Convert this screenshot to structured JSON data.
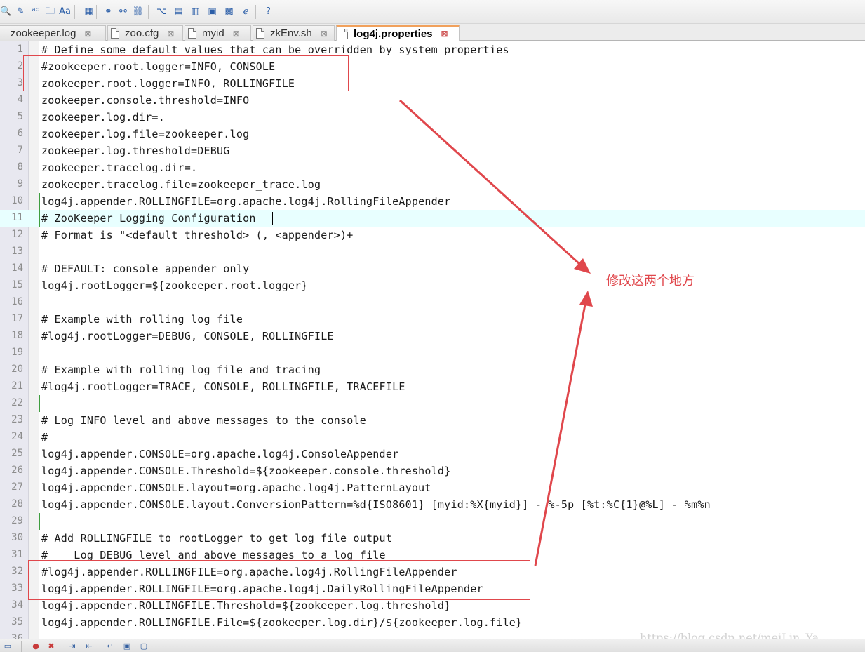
{
  "colors": {
    "annotation": "#e0474c",
    "change_marker": "#3f9e3f",
    "current_line": "#e8ffff",
    "active_tab_accent": "#f1a15c"
  },
  "toolbar": {
    "icons": [
      {
        "name": "find-icon",
        "glyph": "🔍"
      },
      {
        "name": "edit-note-icon",
        "glyph": "✎"
      },
      {
        "name": "replace-abc-icon",
        "glyph": "ᵃᶜ"
      },
      {
        "name": "find-in-files-icon",
        "glyph": "🗀"
      },
      {
        "name": "text-format-icon",
        "glyph": "Aa"
      },
      {
        "name": "calculator-icon",
        "glyph": "▦"
      },
      {
        "name": "link-icon",
        "glyph": "⚭"
      },
      {
        "name": "link-alt-icon",
        "glyph": "⚯"
      },
      {
        "name": "link-group-icon",
        "glyph": "⛓"
      },
      {
        "name": "tree-view-icon",
        "glyph": "⌥"
      },
      {
        "name": "panel-left-icon",
        "glyph": "▤"
      },
      {
        "name": "panel-right-icon",
        "glyph": "▥"
      },
      {
        "name": "window-icon",
        "glyph": "▣"
      },
      {
        "name": "grid-icon",
        "glyph": "▩"
      },
      {
        "name": "browser-icon",
        "glyph": "ℯ"
      },
      {
        "name": "help-icon",
        "glyph": "?"
      }
    ]
  },
  "tabs": [
    {
      "label": "zookeeper.log",
      "active": false
    },
    {
      "label": "zoo.cfg",
      "active": false
    },
    {
      "label": "myid",
      "active": false
    },
    {
      "label": "zkEnv.sh",
      "active": false
    },
    {
      "label": "log4j.properties",
      "active": true
    }
  ],
  "tab_close_glyph": "⊠",
  "editor": {
    "current_line": 11,
    "changed_lines": [
      10,
      11,
      22,
      29
    ],
    "lines": [
      {
        "n": "1",
        "text": "# Define some default values that can be overridden by system properties"
      },
      {
        "n": "2",
        "text": "#zookeeper.root.logger=INFO, CONSOLE"
      },
      {
        "n": "3",
        "text": "zookeeper.root.logger=INFO, ROLLINGFILE"
      },
      {
        "n": "4",
        "text": "zookeeper.console.threshold=INFO"
      },
      {
        "n": "5",
        "text": "zookeeper.log.dir=."
      },
      {
        "n": "6",
        "text": "zookeeper.log.file=zookeeper.log"
      },
      {
        "n": "7",
        "text": "zookeeper.log.threshold=DEBUG"
      },
      {
        "n": "8",
        "text": "zookeeper.tracelog.dir=."
      },
      {
        "n": "9",
        "text": "zookeeper.tracelog.file=zookeeper_trace.log"
      },
      {
        "n": "10",
        "text": "log4j.appender.ROLLINGFILE=org.apache.log4j.RollingFileAppender"
      },
      {
        "n": "11",
        "text": "# ZooKeeper Logging Configuration"
      },
      {
        "n": "12",
        "text": "# Format is \"<default threshold> (, <appender>)+"
      },
      {
        "n": "13",
        "text": ""
      },
      {
        "n": "14",
        "text": "# DEFAULT: console appender only"
      },
      {
        "n": "15",
        "text": "log4j.rootLogger=${zookeeper.root.logger}"
      },
      {
        "n": "16",
        "text": ""
      },
      {
        "n": "17",
        "text": "# Example with rolling log file"
      },
      {
        "n": "18",
        "text": "#log4j.rootLogger=DEBUG, CONSOLE, ROLLINGFILE"
      },
      {
        "n": "19",
        "text": ""
      },
      {
        "n": "20",
        "text": "# Example with rolling log file and tracing"
      },
      {
        "n": "21",
        "text": "#log4j.rootLogger=TRACE, CONSOLE, ROLLINGFILE, TRACEFILE"
      },
      {
        "n": "22",
        "text": ""
      },
      {
        "n": "23",
        "text": "# Log INFO level and above messages to the console"
      },
      {
        "n": "24",
        "text": "#"
      },
      {
        "n": "25",
        "text": "log4j.appender.CONSOLE=org.apache.log4j.ConsoleAppender"
      },
      {
        "n": "26",
        "text": "log4j.appender.CONSOLE.Threshold=${zookeeper.console.threshold}"
      },
      {
        "n": "27",
        "text": "log4j.appender.CONSOLE.layout=org.apache.log4j.PatternLayout"
      },
      {
        "n": "28",
        "text": "log4j.appender.CONSOLE.layout.ConversionPattern=%d{ISO8601} [myid:%X{myid}] - %-5p [%t:%C{1}@%L] - %m%n"
      },
      {
        "n": "29",
        "text": ""
      },
      {
        "n": "30",
        "text": "# Add ROLLINGFILE to rootLogger to get log file output"
      },
      {
        "n": "31",
        "text": "#    Log DEBUG level and above messages to a log file"
      },
      {
        "n": "32",
        "text": "#log4j.appender.ROLLINGFILE=org.apache.log4j.RollingFileAppender"
      },
      {
        "n": "33",
        "text": "log4j.appender.ROLLINGFILE=org.apache.log4j.DailyRollingFileAppender"
      },
      {
        "n": "34",
        "text": "log4j.appender.ROLLINGFILE.Threshold=${zookeeper.log.threshold}"
      },
      {
        "n": "35",
        "text": "log4j.appender.ROLLINGFILE.File=${zookeeper.log.dir}/${zookeeper.log.file}"
      },
      {
        "n": "36",
        "text": ""
      }
    ]
  },
  "annotation": {
    "label": "修改这两个地方"
  },
  "watermark": "https://blog.csdn.net/meiLin_Ya",
  "statusbar": {
    "icons": [
      {
        "name": "print-icon",
        "glyph": "▭"
      },
      {
        "name": "record-macro-icon",
        "glyph": "●"
      },
      {
        "name": "stop-macro-icon",
        "glyph": "✖"
      },
      {
        "name": "indent-icon",
        "glyph": "⇥"
      },
      {
        "name": "outdent-icon",
        "glyph": "⇤"
      },
      {
        "name": "wrap-icon",
        "glyph": "↵"
      },
      {
        "name": "view-panel-icon",
        "glyph": "▣"
      },
      {
        "name": "view-panel-alt-icon",
        "glyph": "▢"
      }
    ]
  }
}
